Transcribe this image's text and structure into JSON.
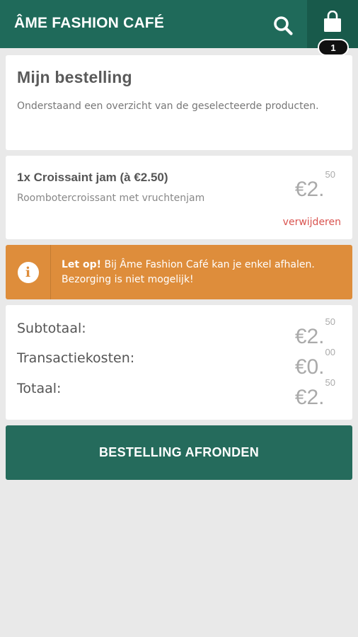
{
  "header": {
    "brand": "ÂME FASHION CAFÉ",
    "cart_count": "1"
  },
  "order": {
    "title": "Mijn bestelling",
    "description": "Onderstaand een overzicht van de geselecteerde producten."
  },
  "item": {
    "title": "1x Croissaint jam (à €2.50)",
    "description": "Roombotercroissant met vruchtenjam",
    "price_main": "€2.",
    "price_cents": "50",
    "remove_label": "verwijderen"
  },
  "notice": {
    "bold": "Let op!",
    "text": " Bij Âme Fashion Café kan je enkel afhalen. Bezorging is niet mogelijk!"
  },
  "totals": {
    "subtotal_label": "Subtotaal:",
    "subtotal_main": "€2.",
    "subtotal_cents": "50",
    "fee_label": "Transactiekosten:",
    "fee_main": "€0.",
    "fee_cents": "00",
    "total_label": "Totaal:",
    "total_main": "€2.",
    "total_cents": "50"
  },
  "checkout": {
    "label": "BESTELLING AFRONDEN"
  },
  "colors": {
    "header": "#1f6a5a",
    "notice": "#de8d3b",
    "button": "#256b5c",
    "remove": "#d9534f"
  },
  "icons": [
    "search-icon",
    "shopping-bag-icon",
    "info-icon"
  ]
}
